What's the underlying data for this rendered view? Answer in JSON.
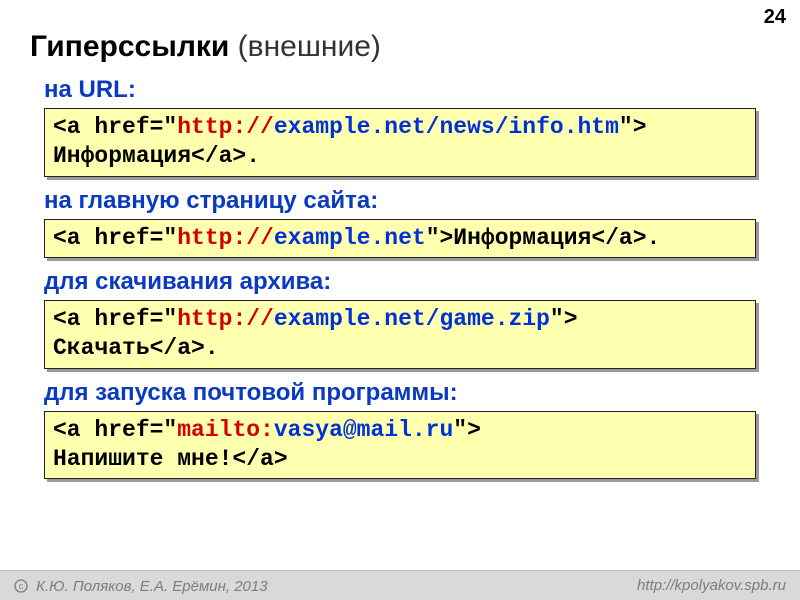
{
  "pageNumber": "24",
  "title": {
    "bold": "Гиперссылки",
    "rest": " (внешние)"
  },
  "sections": [
    {
      "heading": "на URL:",
      "code": [
        {
          "cls": "c-black",
          "txt": "<a href=\""
        },
        {
          "cls": "c-red",
          "txt": "http://"
        },
        {
          "cls": "c-blue",
          "txt": "example.net/news/info.htm"
        },
        {
          "cls": "c-black",
          "txt": "\"> "
        },
        {
          "break": true
        },
        {
          "cls": "c-black",
          "txt": "Информация</a>."
        }
      ]
    },
    {
      "heading": "на главную страницу сайта:",
      "code": [
        {
          "cls": "c-black",
          "txt": "<a href=\""
        },
        {
          "cls": "c-red",
          "txt": "http://"
        },
        {
          "cls": "c-blue",
          "txt": "example.net"
        },
        {
          "cls": "c-black",
          "txt": "\">Информация</a>."
        }
      ]
    },
    {
      "heading": "для скачивания архива:",
      "code": [
        {
          "cls": "c-black",
          "txt": "<a href=\""
        },
        {
          "cls": "c-red",
          "txt": "http://"
        },
        {
          "cls": "c-blue",
          "txt": "example.net/game.zip"
        },
        {
          "cls": "c-black",
          "txt": "\"> "
        },
        {
          "break": true
        },
        {
          "cls": "c-black",
          "txt": "Скачать</a>."
        }
      ]
    },
    {
      "heading": "для запуска почтовой программы:",
      "code": [
        {
          "cls": "c-black",
          "txt": "<a href=\""
        },
        {
          "cls": "c-red",
          "txt": "mailto:"
        },
        {
          "cls": "c-blue",
          "txt": "vasya@mail.ru"
        },
        {
          "cls": "c-black",
          "txt": "\"> "
        },
        {
          "break": true
        },
        {
          "cls": "c-black",
          "txt": "Напишите мне!</a>"
        }
      ]
    }
  ],
  "footer": {
    "left": "К.Ю. Поляков, Е.А. Ерёмин, 2013",
    "right": "http://kpolyakov.spb.ru"
  }
}
